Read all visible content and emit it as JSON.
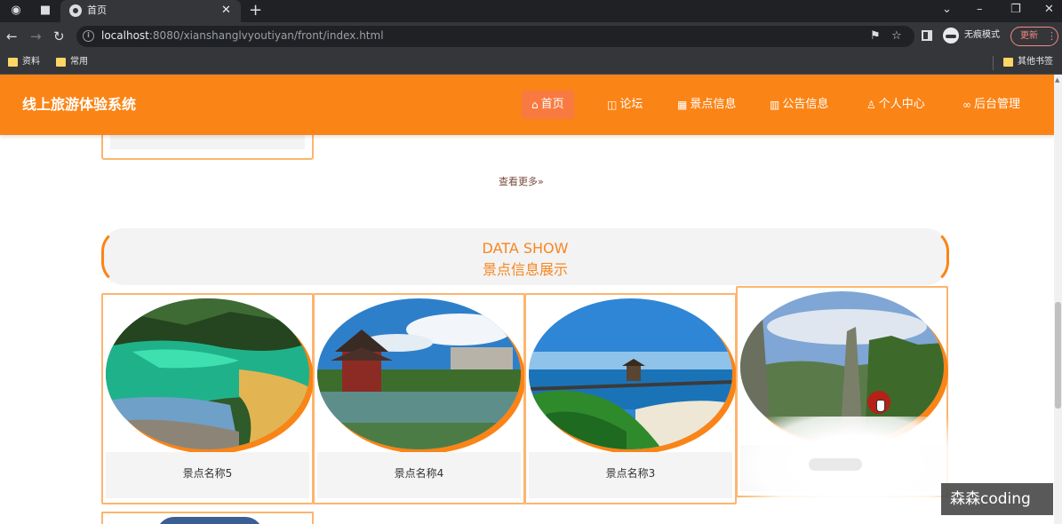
{
  "browser": {
    "tab_title": "首页",
    "url_host": "localhost",
    "url_path": ":8080/xianshanglvyoutiyan/front/index.html",
    "incognito_label": "无痕模式",
    "update_label": "更新",
    "bookmarks": [
      "资料",
      "常用"
    ],
    "other_bookmarks": "其他书签"
  },
  "header": {
    "site_title": "线上旅游体验系统",
    "menu": [
      {
        "icon": "home-icon",
        "label": "首页",
        "active": true
      },
      {
        "icon": "forum-icon",
        "label": "论坛"
      },
      {
        "icon": "scenic-icon",
        "label": "景点信息"
      },
      {
        "icon": "notice-icon",
        "label": "公告信息"
      },
      {
        "icon": "user-icon",
        "label": "个人中心"
      },
      {
        "icon": "link-icon",
        "label": "后台管理"
      }
    ]
  },
  "more_link": "查看更多",
  "section": {
    "title_en": "DATA SHOW",
    "title_cn": "景点信息展示"
  },
  "cards": [
    {
      "name": "景点名称5"
    },
    {
      "name": "景点名称4"
    },
    {
      "name": "景点名称3"
    }
  ],
  "watermark": "森森coding",
  "colors": {
    "accent": "#fb8416",
    "title": "#f7861f"
  }
}
